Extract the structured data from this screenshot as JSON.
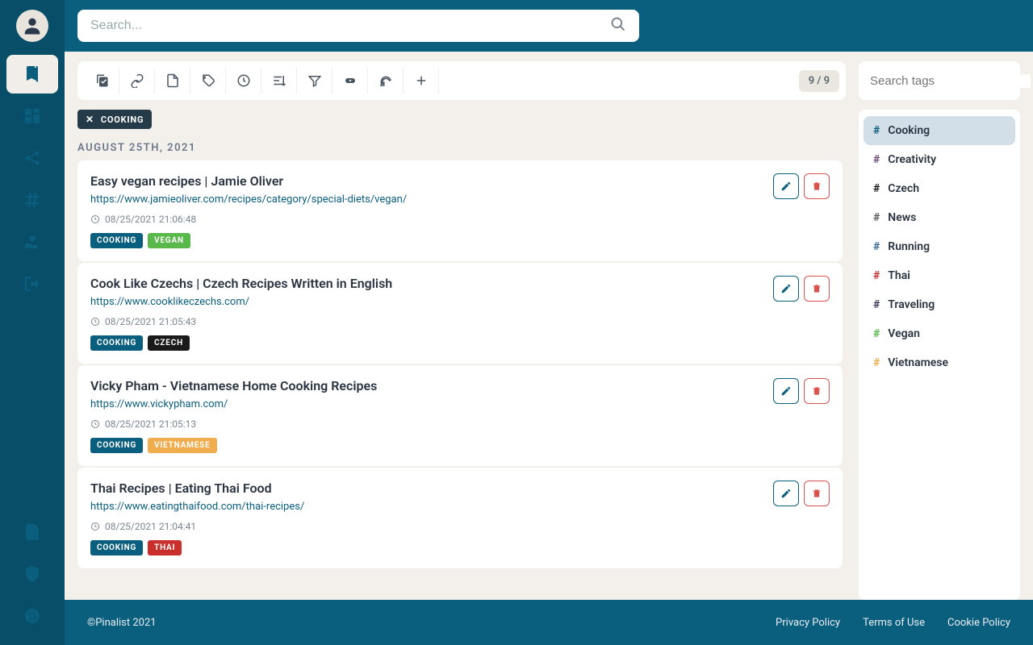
{
  "search": {
    "placeholder": "Search..."
  },
  "toolbar": {
    "counter": "9 / 9"
  },
  "filter": {
    "label": "COOKING"
  },
  "date_header": "AUGUST 25TH, 2021",
  "bookmarks": [
    {
      "title": "Easy vegan recipes | Jamie Oliver",
      "url": "https://www.jamieoliver.com/recipes/category/special-diets/vegan/",
      "ts": "08/25/2021 21:06:48",
      "tags": [
        {
          "label": "COOKING",
          "color": "#0a5e7e"
        },
        {
          "label": "VEGAN",
          "color": "#58b84a"
        }
      ]
    },
    {
      "title": "Cook Like Czechs | Czech Recipes Written in English",
      "url": "https://www.cooklikeczechs.com/",
      "ts": "08/25/2021 21:05:43",
      "tags": [
        {
          "label": "COOKING",
          "color": "#0a5e7e"
        },
        {
          "label": "CZECH",
          "color": "#1a1a1a"
        }
      ]
    },
    {
      "title": "Vicky Pham - Vietnamese Home Cooking Recipes",
      "url": "https://www.vickypham.com/",
      "ts": "08/25/2021 21:05:13",
      "tags": [
        {
          "label": "COOKING",
          "color": "#0a5e7e"
        },
        {
          "label": "VIETNAMESE",
          "color": "#f0ad4e"
        }
      ]
    },
    {
      "title": "Thai Recipes | Eating Thai Food",
      "url": "https://www.eatingthaifood.com/thai-recipes/",
      "ts": "08/25/2021 21:04:41",
      "tags": [
        {
          "label": "COOKING",
          "color": "#0a5e7e"
        },
        {
          "label": "THAI",
          "color": "#c9302c"
        }
      ]
    }
  ],
  "tag_search": {
    "placeholder": "Search tags"
  },
  "tags": [
    {
      "label": "Cooking",
      "hash_color": "#0a5e7e",
      "selected": true
    },
    {
      "label": "Creativity",
      "hash_color": "#6a4a7c"
    },
    {
      "label": "Czech",
      "hash_color": "#1a1a1a"
    },
    {
      "label": "News",
      "hash_color": "#5a5a5a"
    },
    {
      "label": "Running",
      "hash_color": "#3a6a9a"
    },
    {
      "label": "Thai",
      "hash_color": "#c9302c"
    },
    {
      "label": "Traveling",
      "hash_color": "#3a3a5a"
    },
    {
      "label": "Vegan",
      "hash_color": "#58b84a"
    },
    {
      "label": "Vietnamese",
      "hash_color": "#f0ad4e"
    }
  ],
  "footer": {
    "copyright": "©Pinalist 2021",
    "links": [
      "Privacy Policy",
      "Terms of Use",
      "Cookie Policy"
    ]
  }
}
